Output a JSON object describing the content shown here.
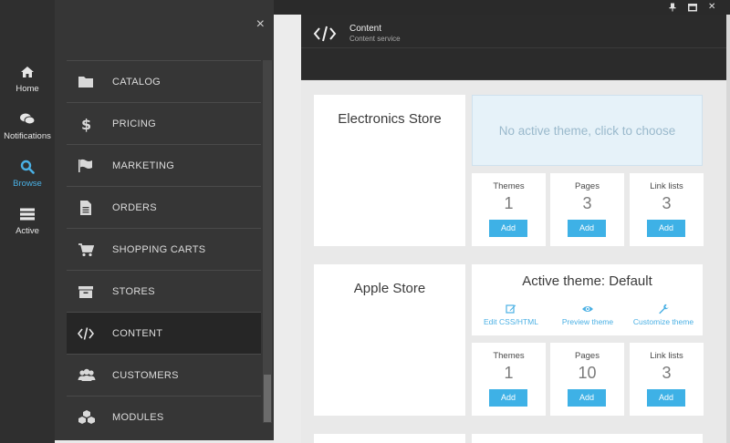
{
  "rail": {
    "items": [
      {
        "label": "Home",
        "icon": "home-icon"
      },
      {
        "label": "Notifications",
        "icon": "chat-icon"
      },
      {
        "label": "Browse",
        "icon": "search-icon"
      },
      {
        "label": "Active",
        "icon": "stack-icon"
      }
    ],
    "active_color": "#4ab0e4"
  },
  "menu": {
    "close_glyph": "×",
    "items": [
      {
        "label": "CATALOG",
        "icon": "folder-icon"
      },
      {
        "label": "PRICING",
        "icon": "dollar-icon"
      },
      {
        "label": "MARKETING",
        "icon": "flag-icon"
      },
      {
        "label": "ORDERS",
        "icon": "document-icon"
      },
      {
        "label": "SHOPPING CARTS",
        "icon": "cart-icon"
      },
      {
        "label": "STORES",
        "icon": "archive-icon"
      },
      {
        "label": "CONTENT",
        "icon": "code-icon"
      },
      {
        "label": "CUSTOMERS",
        "icon": "users-icon"
      },
      {
        "label": "MODULES",
        "icon": "cubes-icon"
      }
    ],
    "active_item": "CONTENT"
  },
  "window": {
    "controls": [
      "pin-icon",
      "maximize-icon",
      "close-icon"
    ],
    "close_glyph": "✕"
  },
  "header": {
    "title": "Content",
    "subtitle": "Content service",
    "icon": "code-icon"
  },
  "stores": [
    {
      "name": "Electronics Store",
      "theme_text": "No active theme, click to choose",
      "stats": [
        {
          "label": "Themes",
          "value": "1",
          "button": "Add"
        },
        {
          "label": "Pages",
          "value": "3",
          "button": "Add"
        },
        {
          "label": "Link lists",
          "value": "3",
          "button": "Add"
        }
      ]
    },
    {
      "name": "Apple Store",
      "theme_text": "Active theme: Default",
      "actions": [
        {
          "label": "Edit CSS/HTML",
          "icon": "edit-icon"
        },
        {
          "label": "Preview theme",
          "icon": "eye-icon"
        },
        {
          "label": "Customize theme",
          "icon": "wrench-icon"
        }
      ],
      "stats": [
        {
          "label": "Themes",
          "value": "1",
          "button": "Add"
        },
        {
          "label": "Pages",
          "value": "10",
          "button": "Add"
        },
        {
          "label": "Link lists",
          "value": "3",
          "button": "Add"
        }
      ]
    }
  ],
  "colors": {
    "accent": "#3eb1e6",
    "no_theme_bg": "#e6f2f9"
  }
}
